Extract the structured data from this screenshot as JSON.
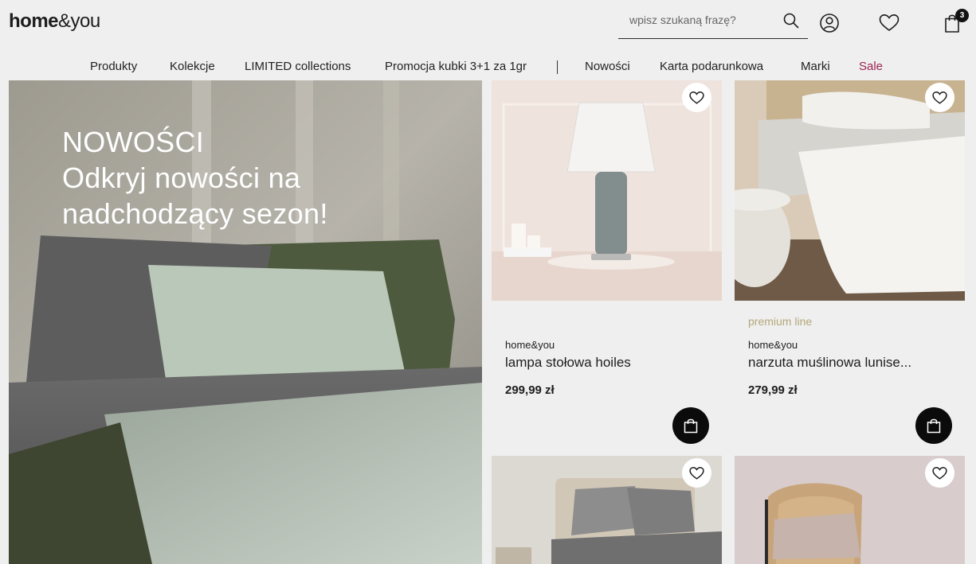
{
  "header": {
    "logo_bold": "home",
    "logo_regular": "&you",
    "search_placeholder": "wpisz szukaną frazę?",
    "cart_count": "3"
  },
  "nav": {
    "items": [
      "Produkty",
      "Kolekcje",
      "LIMITED collections",
      "Promocja kubki 3+1 za 1gr",
      "Nowości",
      "Karta podarunkowa",
      "Marki",
      "Sale"
    ],
    "sale_color": "#9b2352"
  },
  "hero": {
    "line1": "NOWOŚCI",
    "line2": "Odkryj nowości na",
    "line3": "nadchodzący sezon!"
  },
  "products": [
    {
      "tag": "",
      "brand": "home&you",
      "name": "lampa stołowa hoiles",
      "price": "299,99 zł"
    },
    {
      "tag": "premium line",
      "brand": "home&you",
      "name": "narzuta muślinowa lunise...",
      "price": "279,99 zł"
    }
  ],
  "icons": {
    "search": "search-icon",
    "account": "user-icon",
    "wishlist": "heart-icon",
    "cart": "shopping-bag-icon"
  },
  "colors": {
    "background": "#efefef",
    "premium_tag": "#b3a77a",
    "button": "#0b0b0b"
  }
}
